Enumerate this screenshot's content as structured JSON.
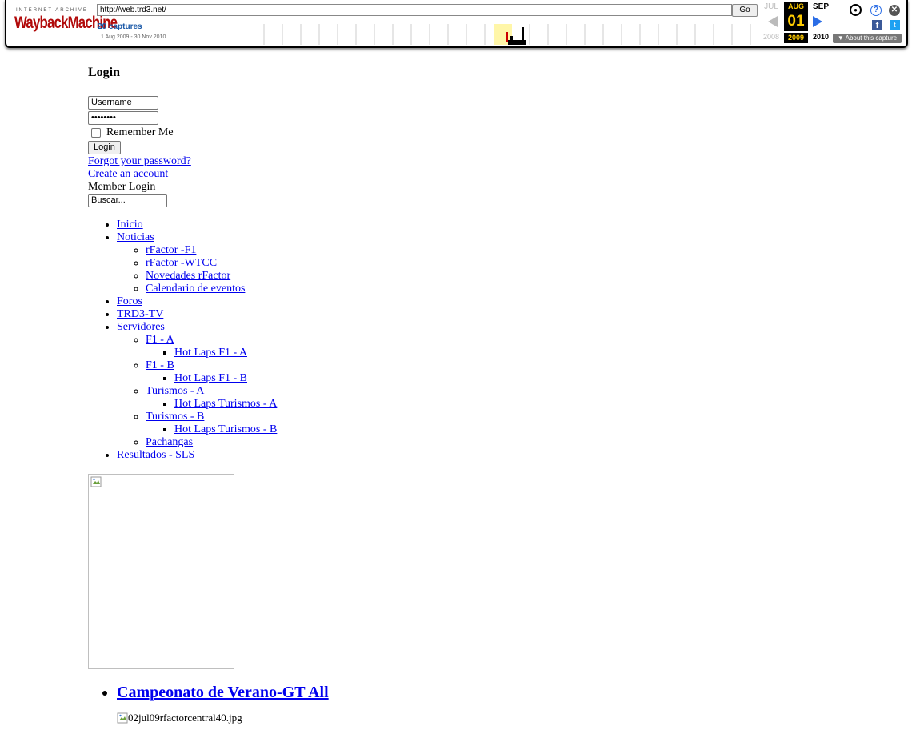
{
  "wayback": {
    "ia_text": "INTERNET ARCHIVE",
    "logo_text": "WaybackMachine",
    "url": "http://web.trd3.net/",
    "go_label": "Go",
    "captures_label": "20 captures",
    "date_range": "1 Aug 2009 - 30 Nov 2010",
    "prev_month": "JUL",
    "current_month": "AUG",
    "next_month": "SEP",
    "current_day": "01",
    "prev_year": "2008",
    "current_year": "2009",
    "next_year": "2010",
    "about_label": "▼ About this capture",
    "icons": [
      "user-icon",
      "help-icon",
      "close-icon",
      "facebook-icon",
      "twitter-icon"
    ]
  },
  "login": {
    "heading": "Login",
    "username_value": "Username",
    "password_value": "••••••••",
    "remember_label": "Remember Me",
    "button_label": "Login",
    "forgot_link": "Forgot your password?",
    "create_link": "Create an account",
    "member_login": "Member Login",
    "search_value": "Buscar..."
  },
  "nav": {
    "inicio": "Inicio",
    "noticias": "Noticias",
    "noticias_sub": [
      "rFactor -F1",
      "rFactor -WTCC",
      "Novedades rFactor",
      "Calendario de eventos"
    ],
    "foros": "Foros",
    "trd3tv": "TRD3-TV",
    "servidores": "Servidores",
    "f1a": "F1 - A",
    "f1a_sub": "Hot Laps F1 - A",
    "f1b": "F1 - B",
    "f1b_sub": "Hot Laps F1 - B",
    "tura": "Turismos - A",
    "tura_sub": "Hot Laps Turismos - A",
    "turb": "Turismos - B",
    "turb_sub": "Hot Laps Turismos - B",
    "pachangas": "Pachangas",
    "resultados": "Resultados - SLS"
  },
  "article": {
    "title": "Campeonato de Verano-GT All",
    "image_alt": "02jul09rfactorcentral40.jpg"
  }
}
